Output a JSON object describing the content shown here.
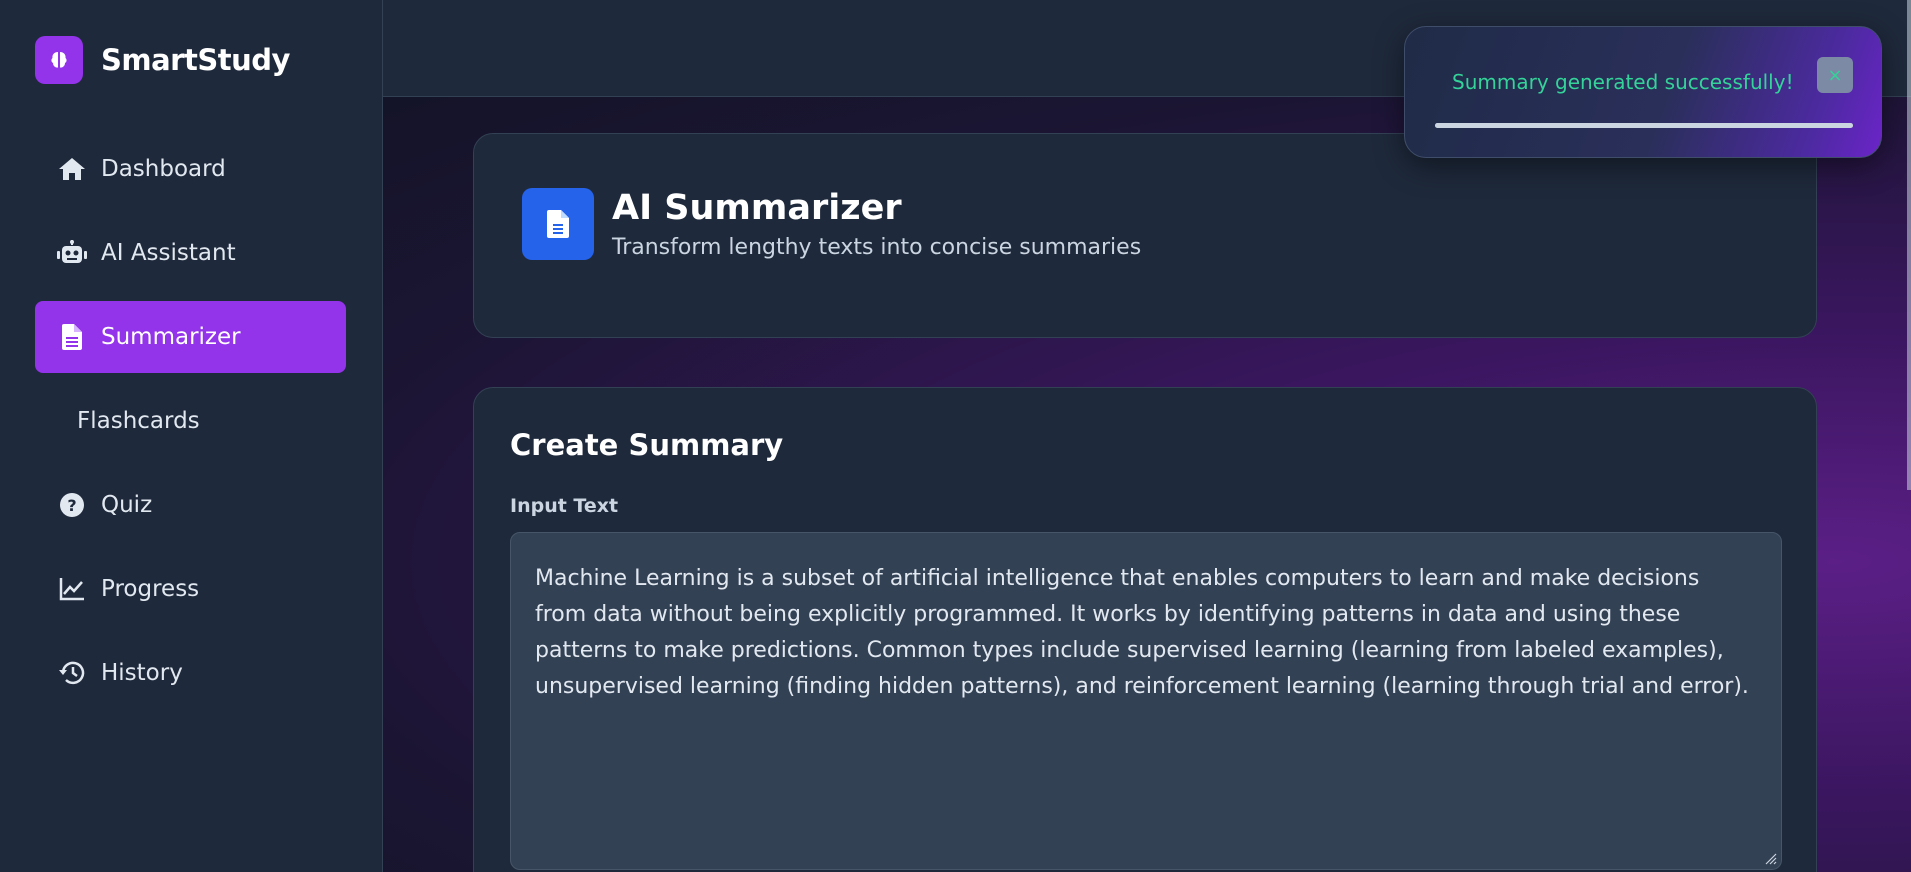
{
  "brand": {
    "name": "SmartStudy",
    "logo_icon": "brain-icon",
    "accent": "#9333ea"
  },
  "sidebar": {
    "items": [
      {
        "label": "Dashboard",
        "icon": "home-icon",
        "active": false
      },
      {
        "label": "AI Assistant",
        "icon": "robot-icon",
        "active": false
      },
      {
        "label": "Summarizer",
        "icon": "document-icon",
        "active": true
      },
      {
        "label": "Flashcards",
        "icon": "",
        "active": false
      },
      {
        "label": "Quiz",
        "icon": "question-circle-icon",
        "active": false
      },
      {
        "label": "Progress",
        "icon": "chart-line-icon",
        "active": false
      },
      {
        "label": "History",
        "icon": "history-icon",
        "active": false
      }
    ]
  },
  "hero": {
    "title": "AI Summarizer",
    "subtitle": "Transform lengthy texts into concise summaries",
    "icon": "document-icon",
    "icon_color": "#2563eb"
  },
  "create": {
    "title": "Create Summary",
    "input_label": "Input Text",
    "input_value": "Machine Learning is a subset of artificial intelligence that enables computers to learn and make decisions from data without being explicitly programmed. It works by identifying patterns in data and using these patterns to make predictions. Common types include supervised learning (learning from labeled examples), unsupervised learning (finding hidden patterns), and reinforcement learning (learning through trial and error)."
  },
  "toast": {
    "message": "Summary generated successfully!",
    "close_label": "×",
    "progress_fraction": 1.0,
    "text_color": "#34d399"
  }
}
